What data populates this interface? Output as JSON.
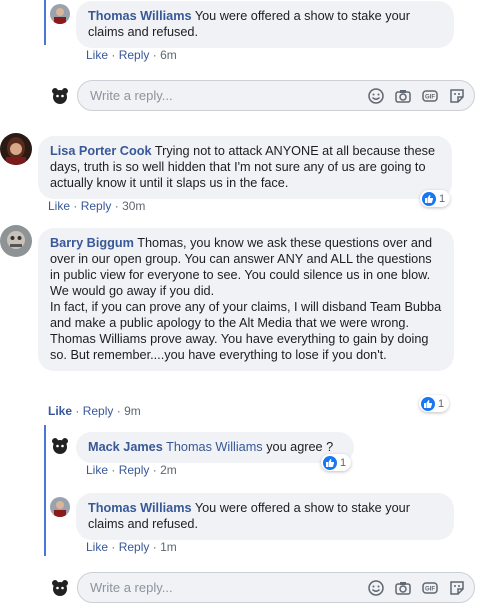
{
  "reply_placeholder": "Write a reply...",
  "action_like": "Like",
  "action_reply": "Reply",
  "dot": "·",
  "comments": {
    "c1": {
      "author": "Thomas Williams",
      "text": "You were offered a show to stake your claims and refused.",
      "time": "6m"
    },
    "c2": {
      "author": "Lisa Porter Cook",
      "text": "Trying not to attack ANYONE at all because these days, truth is so well hidden that I'm not sure any of us are going to actually know it until it slaps us in the face.",
      "time": "30m",
      "reactions": "1"
    },
    "c3": {
      "author": "Barry Biggum",
      "text": "Thomas, you know we ask these questions over and over in our open group. You can answer ANY and ALL the questions in public view for everyone to see. You could silence us in one blow. We would go away if you did.\nIn fact, if you can prove any of your claims, I will disband Team Bubba and make a public apology to the Alt Media that we were wrong.\nThomas Williams prove away. You have everything to gain by doing so. But remember....you have everything to lose if you don't.",
      "time": "9m",
      "reactions": "1"
    },
    "c4": {
      "author": "Mack James",
      "mention": "Thomas Williams",
      "text": "you agree ?",
      "time": "2m",
      "reactions": "1"
    },
    "c5": {
      "author": "Thomas Williams",
      "text": "You were offered a show to stake your claims and refused.",
      "time": "1m"
    }
  },
  "icons": [
    "emoji-icon",
    "camera-icon",
    "gif-icon",
    "sticker-icon"
  ],
  "colors": {
    "link": "#385898",
    "bubble": "#f0f2f5",
    "thread_line": "#4a76d6",
    "like_blue": "#1877f2"
  }
}
